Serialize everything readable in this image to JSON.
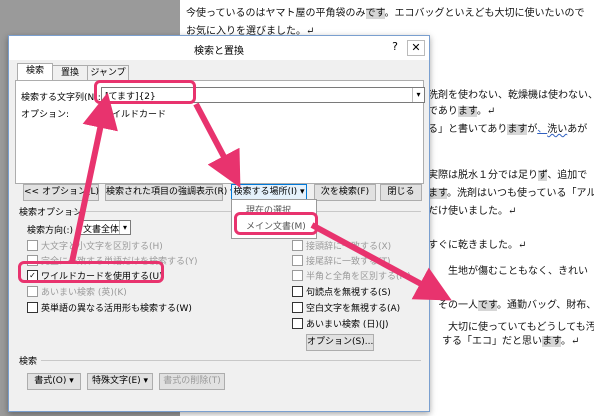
{
  "document": {
    "lines": [
      {
        "parts": [
          "今使っているのはヤマト屋の平角袋のみ",
          "です",
          "。エコバッグといえども大切に使いたいので"
        ]
      },
      {
        "parts": [
          "お気に入りを選びました。↵"
        ]
      },
      {
        "parts": [
          "洗剤を使わない、乾燥機は使わない、"
        ]
      },
      {
        "parts": [
          "であり",
          "ます",
          "。↵"
        ]
      },
      {
        "parts": [
          "る」と書いてあり",
          "ます",
          "が",
          "、",
          "洗い",
          "あが"
        ]
      },
      {
        "parts": [
          "実際は脱水１分では足り",
          "ず",
          "、追加で"
        ]
      },
      {
        "parts": [
          "ます",
          "。洗剤はいつも使っている「アル"
        ]
      },
      {
        "parts": [
          "だけ使いました。↵"
        ]
      },
      {
        "parts": [
          "すぐに乾きました。↵"
        ]
      },
      {
        "parts": [
          "生地が傷むこともなく、きれい"
        ]
      },
      {
        "parts": [
          "その一人",
          "です",
          "。通勤バッグ、財布、"
        ]
      },
      {
        "parts": [
          "大切に使っていてもどうしても汚"
        ]
      },
      {
        "parts": [
          "する「エコ」だと思い",
          "ます",
          "。↵"
        ]
      }
    ]
  },
  "dialog": {
    "title": "検索と置換",
    "help": "?",
    "close": "✕",
    "tabs": [
      "検索",
      "置換",
      "ジャンプ"
    ],
    "search_label": "検索する文字列(N):",
    "search_value": "[てます]{2}",
    "options_label": "オプション:",
    "options_value": "ワイルドカード",
    "buttons": {
      "less_options": "<< オプション(L)",
      "highlight": "検索された項目の強調表示(R) ▾",
      "find_in": "検索する場所(I) ▾",
      "find_next": "次を検索(F)",
      "close": "閉じる"
    },
    "dropdown": [
      "現在の選択",
      "メイン文書(M)"
    ],
    "search_options_title": "検索オプション",
    "direction_label": "検索方向(:)",
    "direction_value": "文書全体",
    "left_options": [
      {
        "label": "大文字と小文字を区別する(H)",
        "checked": false,
        "enabled": false
      },
      {
        "label": "完全に一致する単語だけを検索する(Y)",
        "checked": false,
        "enabled": false
      },
      {
        "label": "ワイルドカードを使用する(U)",
        "checked": true,
        "enabled": true
      },
      {
        "label": "あいまい検索 (英)(K)",
        "checked": false,
        "enabled": false
      },
      {
        "label": "英単語の異なる活用形も検索する(W)",
        "checked": false,
        "enabled": true
      }
    ],
    "right_options": [
      {
        "label": "接頭辞に一致する(X)",
        "checked": false,
        "enabled": false
      },
      {
        "label": "接尾辞に一致する(T)",
        "checked": false,
        "enabled": false
      },
      {
        "label": "半角と全角を区別する(M)",
        "checked": false,
        "enabled": false
      },
      {
        "label": "句読点を無視する(S)",
        "checked": false,
        "enabled": true
      },
      {
        "label": "空白文字を無視する(A)",
        "checked": false,
        "enabled": true
      },
      {
        "label": "あいまい検索 (日)(J)",
        "checked": false,
        "enabled": true
      }
    ],
    "options_button": "オプション(S)...",
    "search_section": "検索",
    "format_button": "書式(O) ▾",
    "special_button": "特殊文字(E) ▾",
    "no_format_button": "書式の削除(T)"
  },
  "colors": {
    "accent": "#e8336e"
  }
}
